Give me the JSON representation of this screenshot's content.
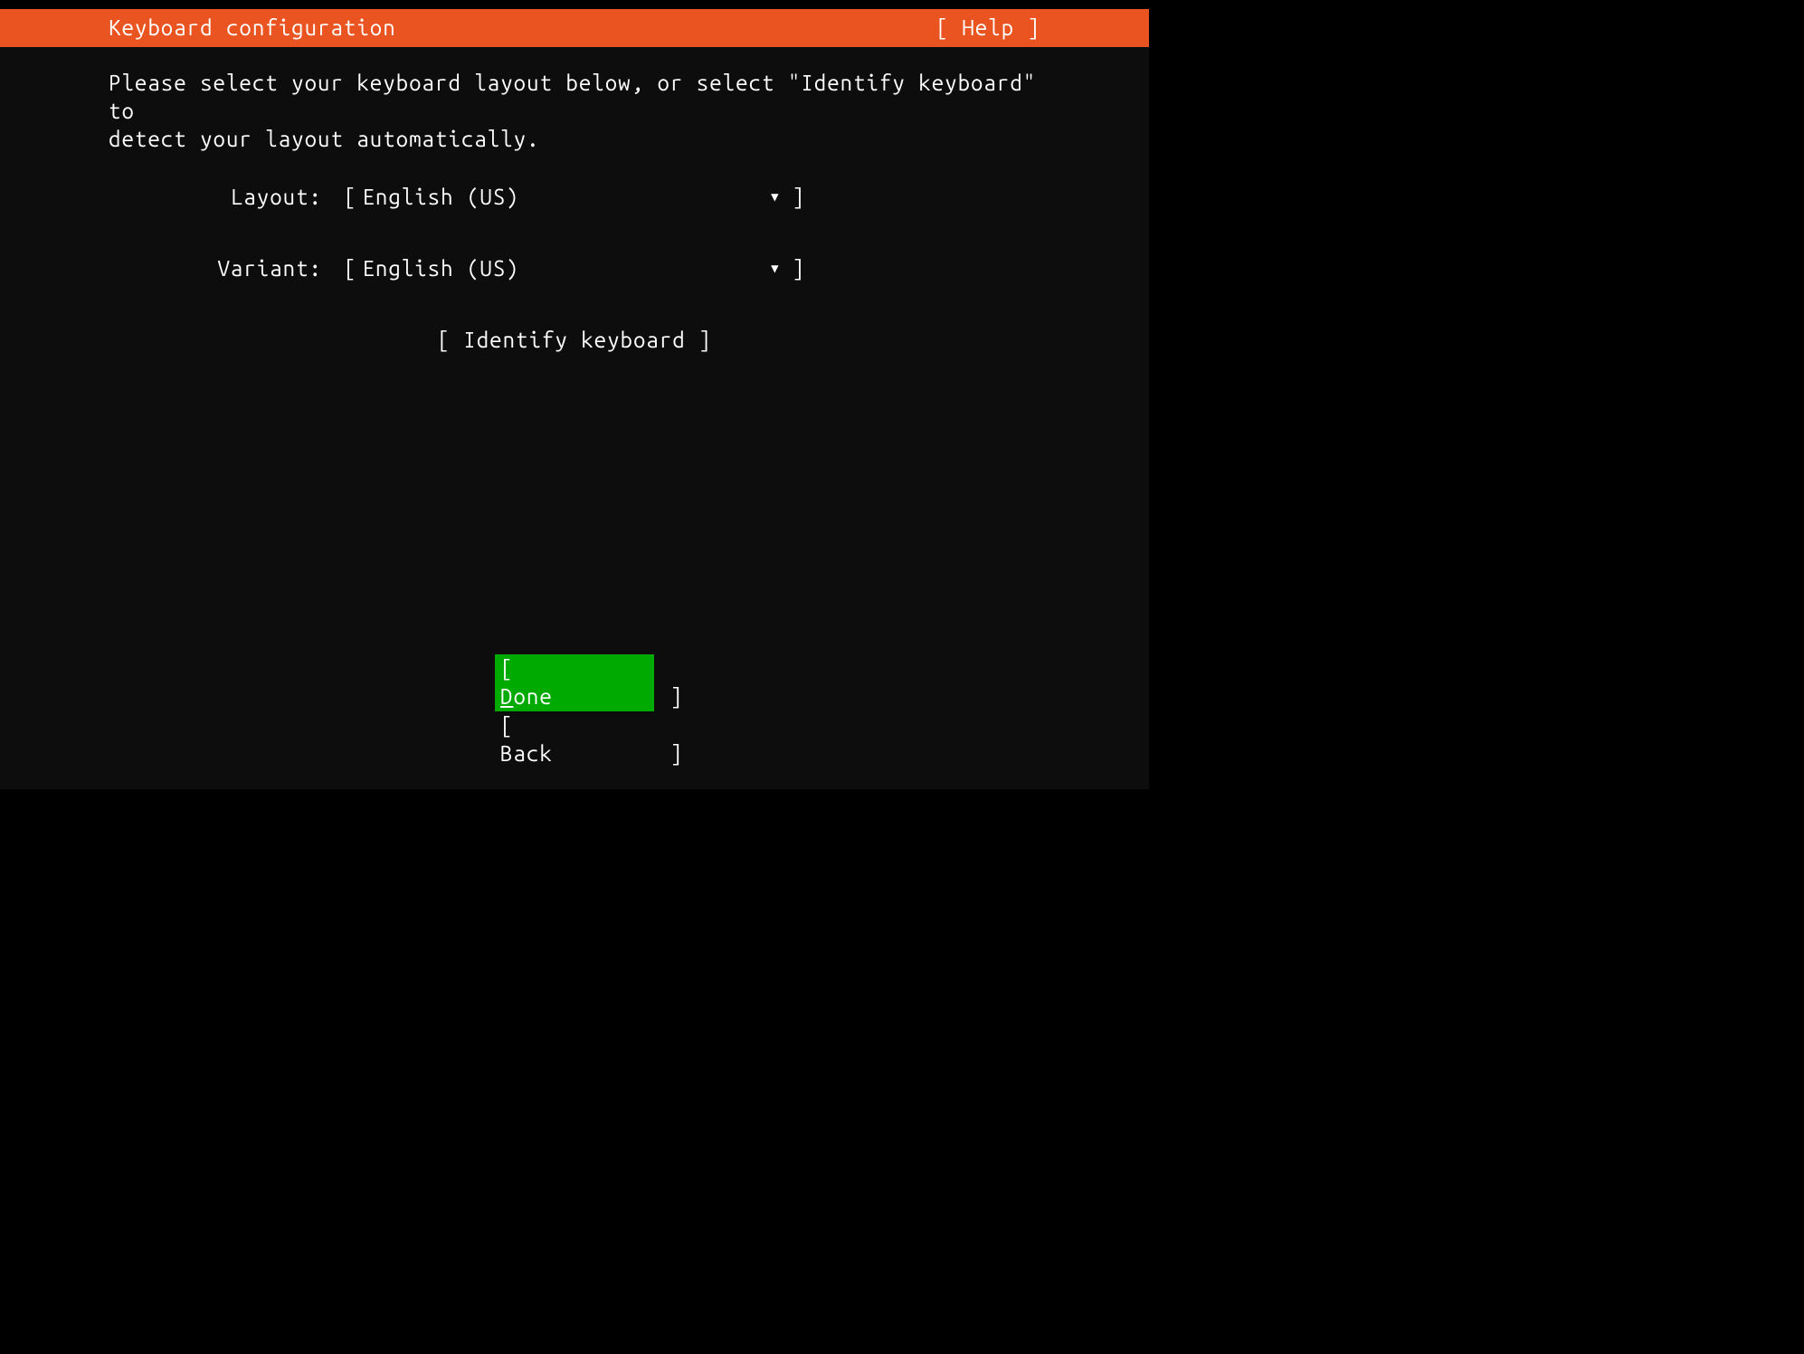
{
  "header": {
    "title": "Keyboard configuration",
    "help_label": "[ Help ]"
  },
  "content": {
    "instruction_text": "Please select your keyboard layout below, or select \"Identify keyboard\" to\ndetect your layout automatically.",
    "layout_row": {
      "label": "Layout:",
      "value": "English (US)"
    },
    "variant_row": {
      "label": "Variant:",
      "value": "English (US)"
    },
    "identify_button_label": "[ Identify keyboard ]"
  },
  "footer": {
    "done_label_first": "D",
    "done_label_rest": "one",
    "back_label": "Back"
  },
  "colors": {
    "header_bg": "#e95420",
    "body_bg": "#0d0d0d",
    "text": "#ffffff",
    "button_highlight": "#00aa00"
  }
}
